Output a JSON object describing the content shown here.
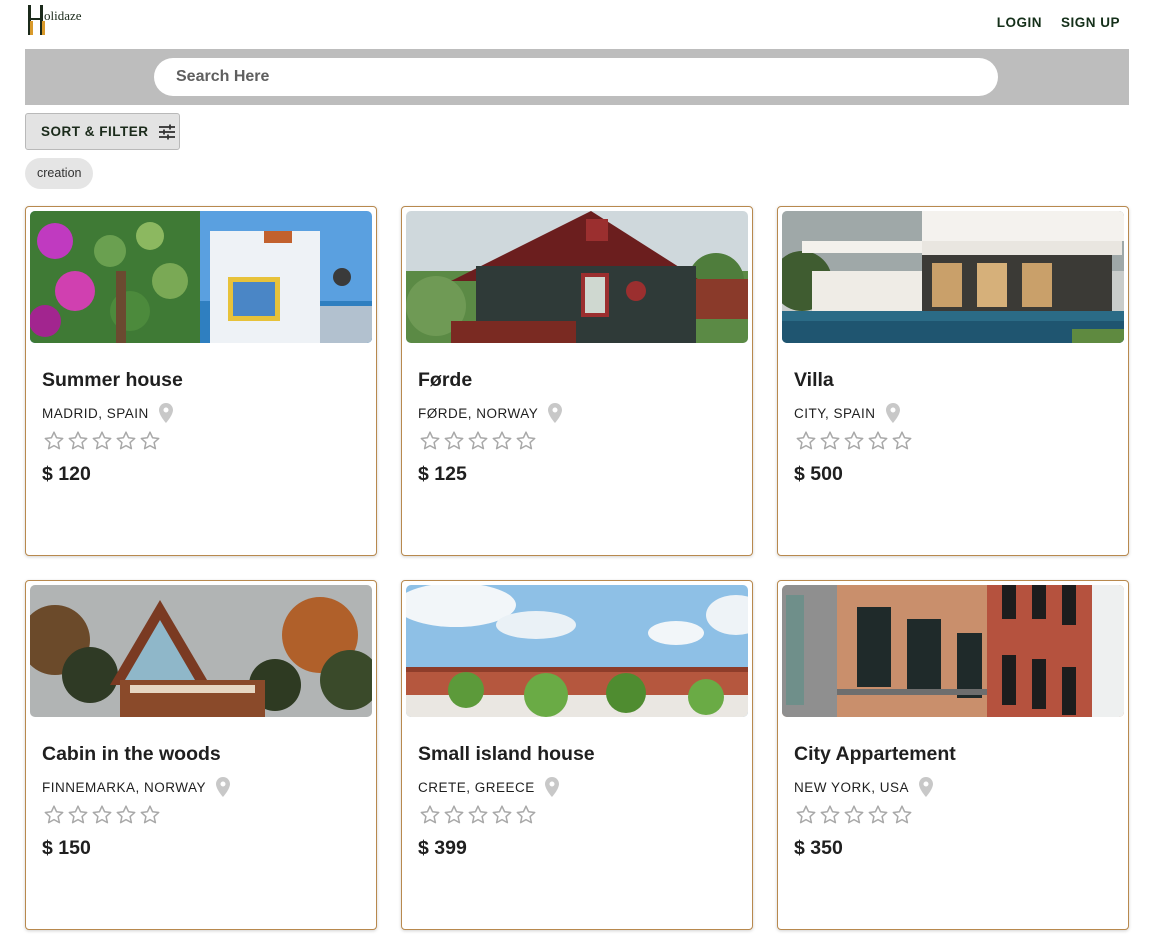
{
  "header": {
    "logo_text": "olidaze",
    "nav": [
      "LOGIN",
      "SIGN UP"
    ]
  },
  "search": {
    "placeholder": "Search Here"
  },
  "toolbar": {
    "sort_label": "SORT & FILTER",
    "chip_label": "creation"
  },
  "listings": [
    {
      "title": "Summer house",
      "location": "MADRID, SPAIN",
      "price": "$ 120",
      "rating": 0,
      "image": "summer-house-photo"
    },
    {
      "title": "Førde",
      "location": "FØRDE, NORWAY",
      "price": "$ 125",
      "rating": 0,
      "image": "forde-house-photo"
    },
    {
      "title": "Villa",
      "location": "CITY, SPAIN",
      "price": "$ 500",
      "rating": 0,
      "image": "villa-photo"
    },
    {
      "title": "Cabin in the woods",
      "location": "FINNEMARKA, NORWAY",
      "price": "$ 150",
      "rating": 0,
      "image": "cabin-photo"
    },
    {
      "title": "Small island house",
      "location": "CRETE, GREECE",
      "price": "$ 399",
      "rating": 0,
      "image": "island-house-photo"
    },
    {
      "title": "City Appartement",
      "location": "NEW YORK, USA",
      "price": "$ 350",
      "rating": 0,
      "image": "city-apartment-photo"
    }
  ],
  "colors": {
    "accent": "#b8894e",
    "brand": "#15301a",
    "search_band": "#bdbdbd"
  }
}
